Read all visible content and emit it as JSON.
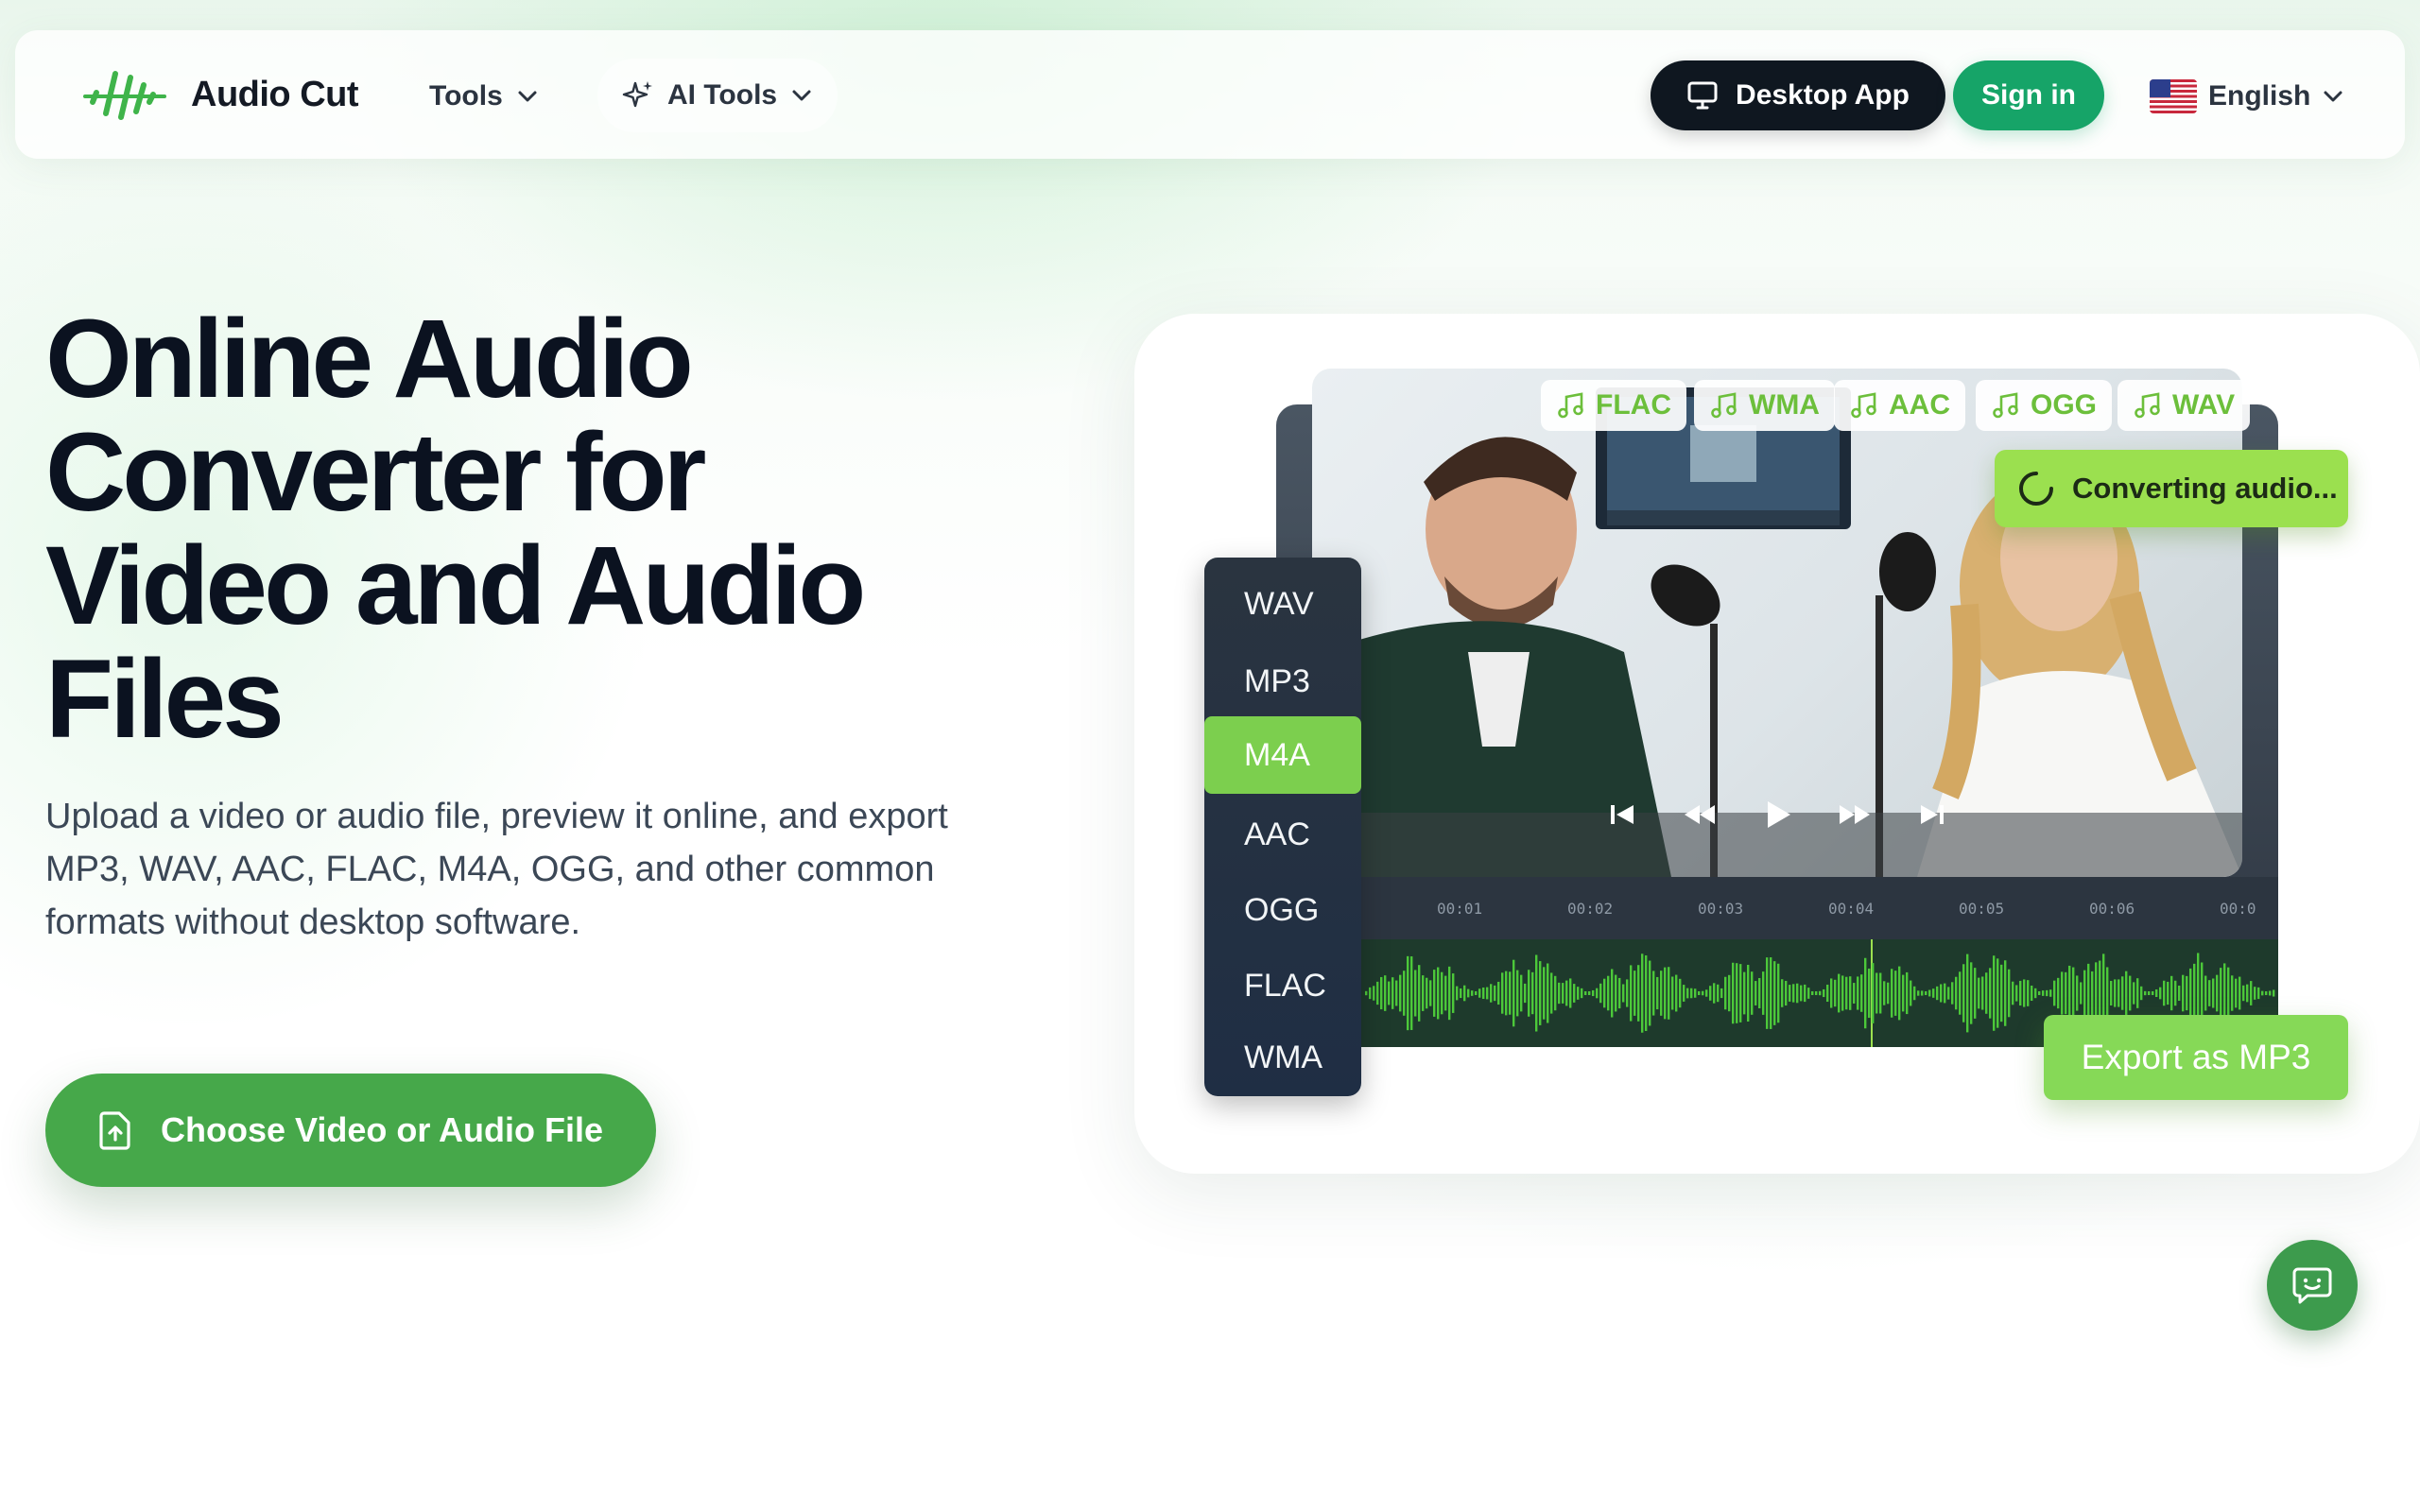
{
  "app": {
    "name": "Audio Cut"
  },
  "nav": {
    "tools_label": "Tools",
    "ai_tools_label": "AI Tools",
    "desktop_app_label": "Desktop App",
    "sign_in_label": "Sign in",
    "language_label": "English"
  },
  "hero": {
    "title_lines": [
      "Online Audio",
      "Converter for",
      "Video and Audio",
      "Files"
    ],
    "subtitle_lines": [
      "Upload a video or audio file, preview it online, and export",
      "MP3, WAV, AAC, FLAC, M4A, OGG, and other common",
      "formats without desktop software."
    ],
    "cta_label": "Choose Video or Audio File"
  },
  "preview": {
    "format_chips": [
      "FLAC",
      "WMA",
      "AAC",
      "OGG",
      "WAV"
    ],
    "format_list": [
      "WAV",
      "MP3",
      "M4A",
      "AAC",
      "OGG",
      "FLAC",
      "WMA"
    ],
    "selected_format": "M4A",
    "status_label": "Converting audio...",
    "export_label": "Export as MP3",
    "timeline_ticks": [
      "00:01",
      "00:02",
      "00:03",
      "00:04",
      "00:05",
      "00:06",
      "00:0"
    ]
  },
  "colors": {
    "brand_green": "#46a84a",
    "sign_in_green": "#16a468",
    "accent_lime": "#9be04f",
    "dark": "#0f1720"
  },
  "icons": {
    "logo": "waveform-logo-icon",
    "desktop": "monitor-icon",
    "ai": "sparkle-icon",
    "flag": "us-flag-icon",
    "upload": "file-upload-icon",
    "chat": "chat-icon",
    "music": "music-note-icon"
  }
}
